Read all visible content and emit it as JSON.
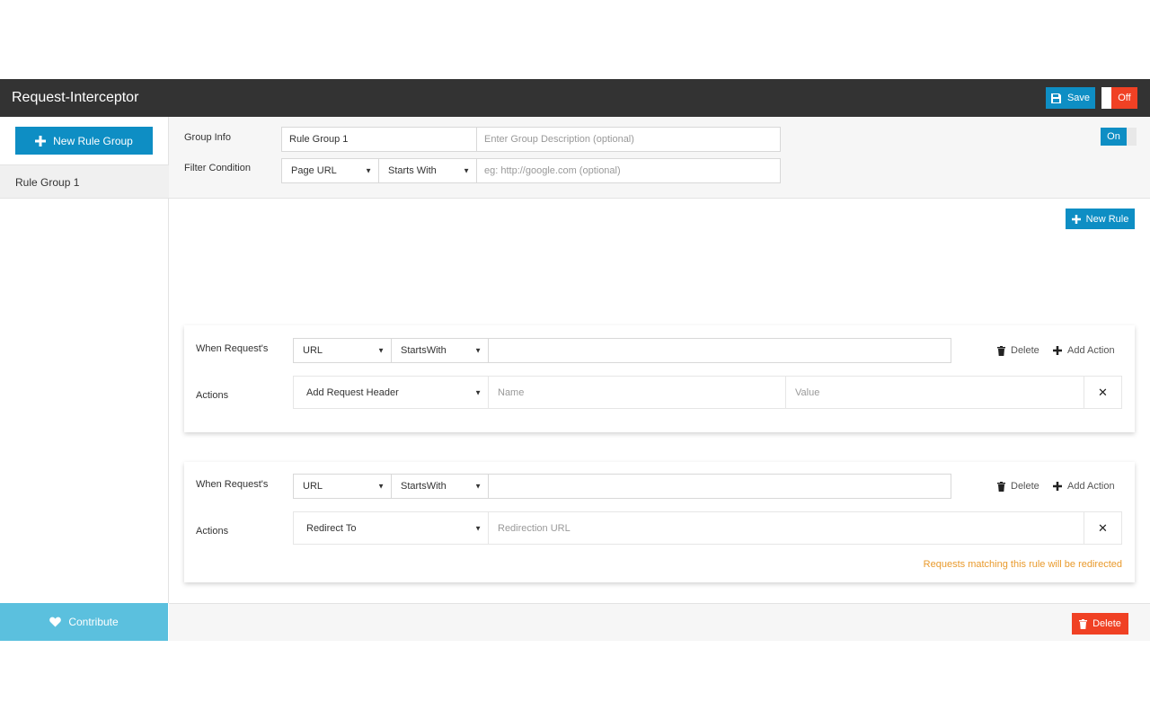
{
  "header": {
    "title": "Request-Interceptor",
    "save_label": "Save",
    "toggle_label": "Off",
    "colors": {
      "bar": "#333333",
      "primary": "#0e8ec4",
      "danger": "#f04124"
    }
  },
  "sidebar": {
    "new_group_label": "New Rule Group",
    "groups": [
      {
        "label": "Rule Group 1"
      }
    ],
    "contribute_label": "Contribute"
  },
  "group": {
    "info_label": "Group Info",
    "name_value": "Rule Group 1",
    "description_placeholder": "Enter Group Description (optional)",
    "filter_label": "Filter Condition",
    "filter_field": "Page URL",
    "filter_operator": "Starts With",
    "filter_placeholder": "eg: http://google.com (optional)",
    "enabled_label": "On"
  },
  "rules_toolbar": {
    "new_rule_label": "New Rule"
  },
  "rules": [
    {
      "when_label": "When Request's",
      "field": "URL",
      "operator": "StartsWith",
      "value": "",
      "delete_label": "Delete",
      "add_action_label": "Add Action",
      "actions_label": "Actions",
      "action": {
        "type": "Add Request Header",
        "name_placeholder": "Name",
        "value_placeholder": "Value"
      }
    },
    {
      "when_label": "When Request's",
      "field": "URL",
      "operator": "StartsWith",
      "value": "",
      "delete_label": "Delete",
      "add_action_label": "Add Action",
      "actions_label": "Actions",
      "action": {
        "type": "Redirect To",
        "url_placeholder": "Redirection URL"
      },
      "note": "Requests matching this rule will be redirected"
    }
  ],
  "footer": {
    "delete_label": "Delete"
  }
}
